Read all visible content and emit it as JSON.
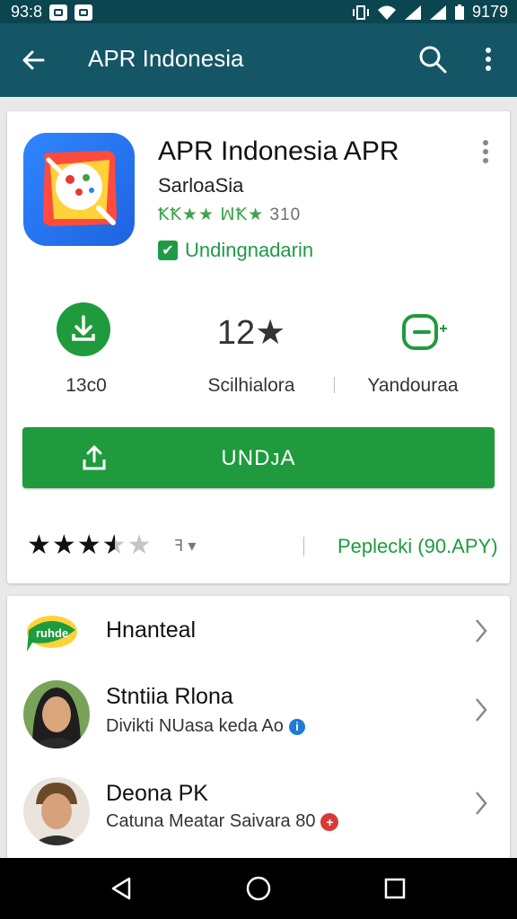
{
  "status_bar": {
    "time": "93:8",
    "battery": "9179"
  },
  "toolbar": {
    "title": "APR Indonesia"
  },
  "app": {
    "title": "APR Indonesia APR",
    "developer": "SarloaSia",
    "stars_text": "ꝀꝀ★★ ꟽꝀ★",
    "rating_count": "310",
    "badge": "Undingnadarin"
  },
  "stats": {
    "downloads": "13c0",
    "rating_value": "12",
    "rating_label": "Scilhialora",
    "third_label": "Yandouraa"
  },
  "install": {
    "label": "UNDᴊA"
  },
  "rating_row": {
    "filled_stars": 3.5,
    "stars_display": "★★★",
    "half_star": "★",
    "empty_star": "★",
    "selector": "ꟻ",
    "link": "Peplecki (90.APY)"
  },
  "list": {
    "header": "Hnanteal",
    "header_logo_text": "ruhde",
    "items": [
      {
        "title": "Stntiia Rlona",
        "subtitle": "Divikti NUasa keda Ao"
      },
      {
        "title": "Deona PK",
        "subtitle": "Catuna Meatar Saivara 80"
      }
    ]
  },
  "colors": {
    "toolbar": "#145666",
    "status": "#0b4550",
    "accent": "#1f9b3d"
  }
}
